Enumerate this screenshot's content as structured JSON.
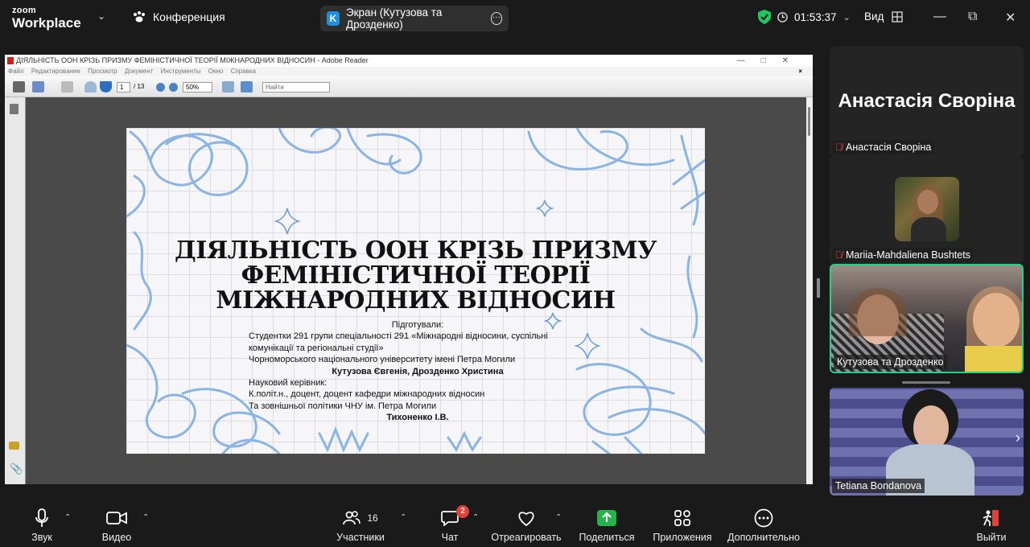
{
  "app": {
    "brand_line1": "zoom",
    "brand_line2": "Workplace",
    "meeting_label": "Конференция"
  },
  "screen_share": {
    "initial": "K",
    "label": "Экран (Кутузова та Дрозденко)"
  },
  "meeting": {
    "timer": "01:53:37",
    "view_label": "Вид"
  },
  "reader": {
    "title": "ДІЯЛЬНІСТЬ ООН КРІЗЬ ПРИЗМУ ФЕМІНІСТИЧНОЇ ТЕОРІЇ МІЖНАРОДНИХ ВІДНОСИН - Adobe Reader",
    "menu": [
      "Файл",
      "Редактирование",
      "Просмотр",
      "Документ",
      "Инструменты",
      "Окно",
      "Справка"
    ],
    "page_current": "1",
    "page_total": "/ 13",
    "zoom": "50%",
    "find_placeholder": "Найти"
  },
  "slide": {
    "title_lines": [
      "ДІЯЛЬНІСТЬ ООН КРІЗЬ ПРИЗМУ",
      "ФЕМІНІСТИЧНОЇ ТЕОРІЇ",
      "МІЖНАРОДНИХ ВІДНОСИН"
    ],
    "prepared_label": "Підготували:",
    "students_line1": "Студентки 291 групи спеціальності 291 «Міжнародні відносини, суспільні",
    "students_line2": "комунікації та регіональні студії»",
    "university": "Чорноморського національного університету імені Петра Могили",
    "authors": "Кутузова Євгенія, Дрозденко Христина",
    "advisor_label": "Науковий керівник:",
    "advisor_line1": "К.політ.н., доцент, доцент кафедри міжнародних відносин",
    "advisor_line2": "Та зовнішньої політики ЧНУ ім. Петра Могили",
    "advisor_name": "Тихоненко І.В."
  },
  "participants": [
    {
      "name": "Анастасія Своріна",
      "big_name": "Анастасія Своріна",
      "muted": true
    },
    {
      "name": "Mariia-Mahdaliena Bushtets",
      "muted": true
    },
    {
      "name": "Кутузова та Дрозденко",
      "muted": false,
      "active_speaker": true
    },
    {
      "name": "Tetiana Bondanova",
      "muted": false
    }
  ],
  "toolbar": {
    "audio": "Звук",
    "video": "Видео",
    "participants": "Участники",
    "participants_count": "16",
    "chat": "Чат",
    "chat_badge": "2",
    "react": "Отреагировать",
    "share": "Поделиться",
    "apps": "Приложения",
    "more": "Дополнительно",
    "leave": "Выйти"
  },
  "colors": {
    "accent_green": "#22c55e",
    "active_border": "#23d18b",
    "mute_red": "#e0413d",
    "share_green": "#25b34b",
    "slide_blue": "#8ab4e3"
  }
}
